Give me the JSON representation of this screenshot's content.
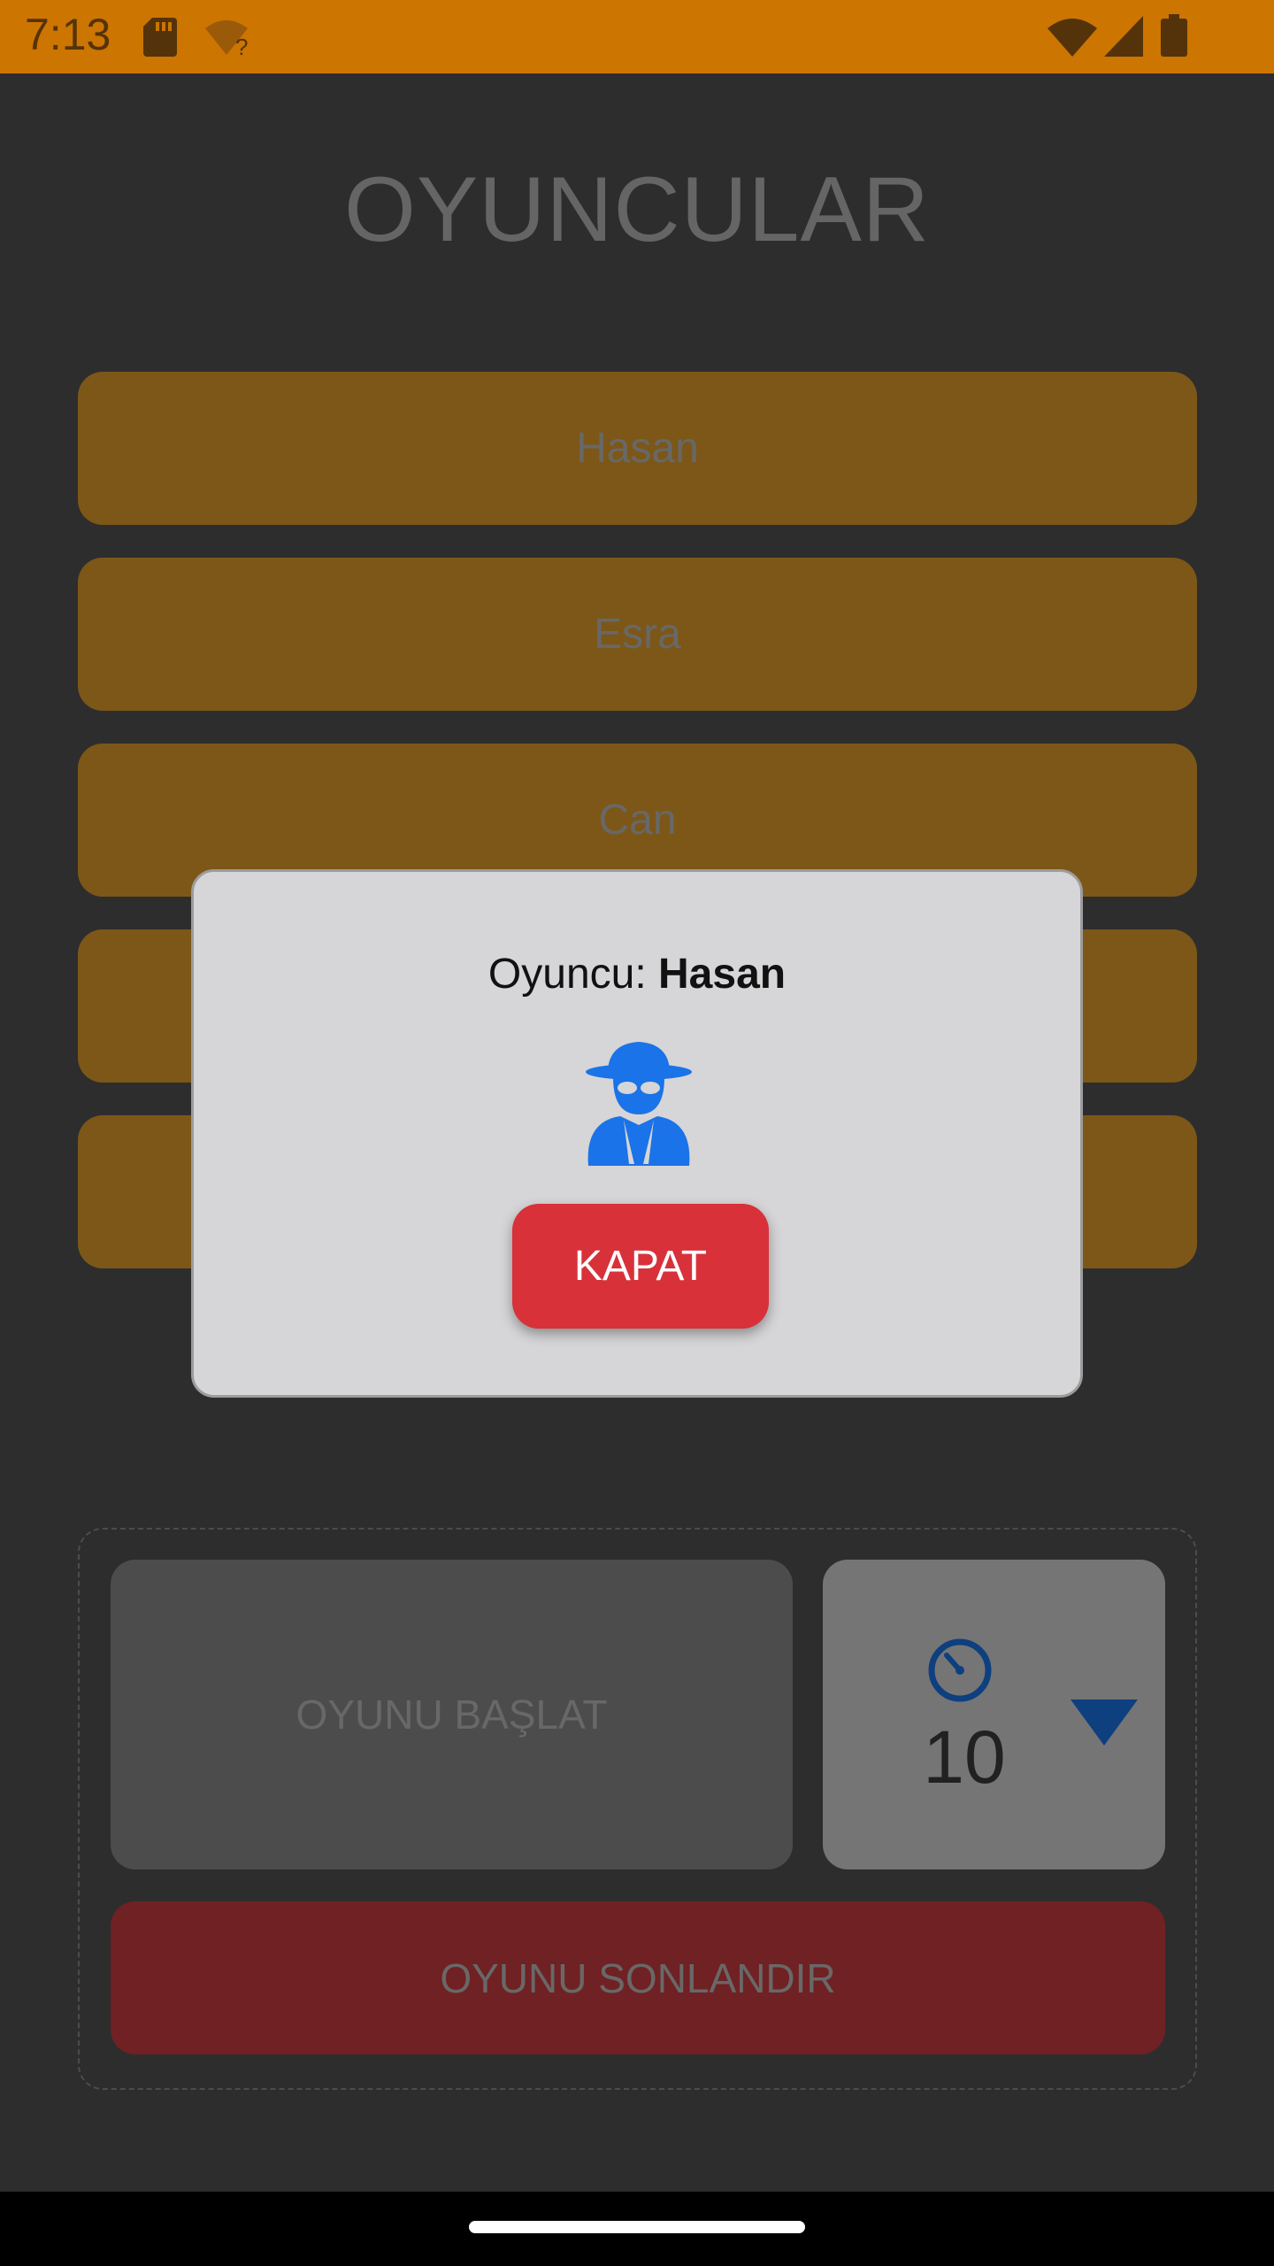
{
  "status_bar": {
    "time": "7:13",
    "icons": [
      "sd-card-icon",
      "wifi-unknown-icon",
      "wifi-icon",
      "signal-icon",
      "battery-icon"
    ]
  },
  "screen": {
    "title": "OYUNCULAR",
    "players": [
      "Hasan",
      "Esra",
      "Can"
    ],
    "start_label": "OYUNU BAŞLAT",
    "timer_value": "10",
    "end_label": "OYUNU SONLANDIR"
  },
  "dialog": {
    "player_label": "Oyuncu:",
    "player_name": "Hasan",
    "role_icon": "spy-icon",
    "close_label": "KAPAT"
  },
  "colors": {
    "status_bar": "#cc7500",
    "player_card": "#e29e2c",
    "end_button": "#cc3d40",
    "close_button": "#d8313a",
    "icon_blue": "#1a73e8"
  }
}
